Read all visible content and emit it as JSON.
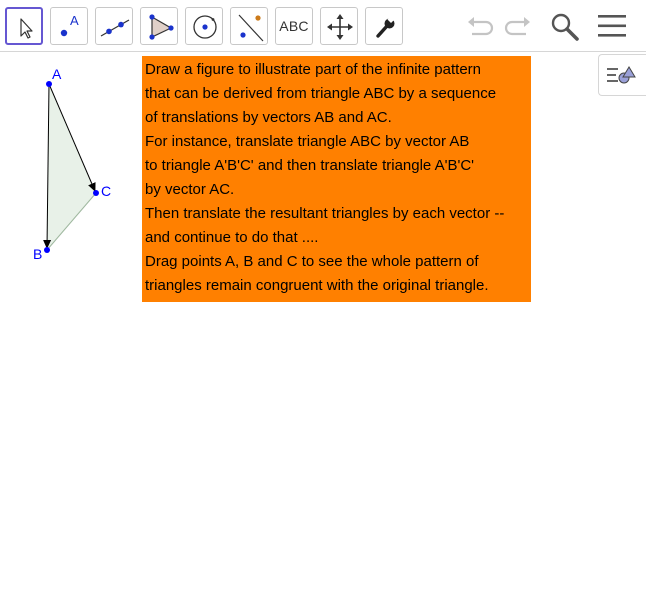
{
  "toolbar": {
    "tools": [
      {
        "name": "move-tool",
        "icon": "pointer-arrow-icon",
        "selected": true
      },
      {
        "name": "point-tool",
        "icon": "point-icon",
        "label": "A"
      },
      {
        "name": "line-tool",
        "icon": "line-through-points-icon"
      },
      {
        "name": "polygon-tool",
        "icon": "polygon-icon"
      },
      {
        "name": "circle-tool",
        "icon": "circle-with-center-icon"
      },
      {
        "name": "perpendicular-line-tool",
        "icon": "perpendicular-line-icon"
      },
      {
        "name": "text-tool",
        "icon": "text-icon",
        "label": "ABC"
      },
      {
        "name": "move-graphics-view-tool",
        "icon": "move-arrows-icon"
      },
      {
        "name": "tools-customize",
        "icon": "wrench-icon"
      }
    ],
    "undo_icon": "undo-icon",
    "redo_icon": "redo-icon",
    "search_icon": "search-icon",
    "menu_icon": "hamburger-menu-icon"
  },
  "side_toggle": {
    "icon": "algebra-view-toggle-icon"
  },
  "canvas": {
    "points": {
      "A": "A",
      "B": "B",
      "C": "C"
    },
    "colors": {
      "point": "#0000ff",
      "polygon_fill": "#e6f0e6",
      "vector": "#000000"
    }
  },
  "info_text": {
    "lines": [
      "Draw a figure to illustrate part of the infinite pattern",
      "that can be derived from triangle ABC by a sequence",
      "of translations by vectors AB and AC.",
      "For instance, translate triangle ABC by vector AB",
      "to triangle A'B'C' and then translate triangle A'B'C'",
      "by vector AC.",
      "Then translate the resultant triangles by each vector --",
      "and continue to do that ....",
      "Drag points A, B and C to see the whole pattern of",
      "triangles remain congruent with the original triangle."
    ],
    "background": "#ff8000"
  },
  "colors": {
    "accent": "#6557d2"
  }
}
